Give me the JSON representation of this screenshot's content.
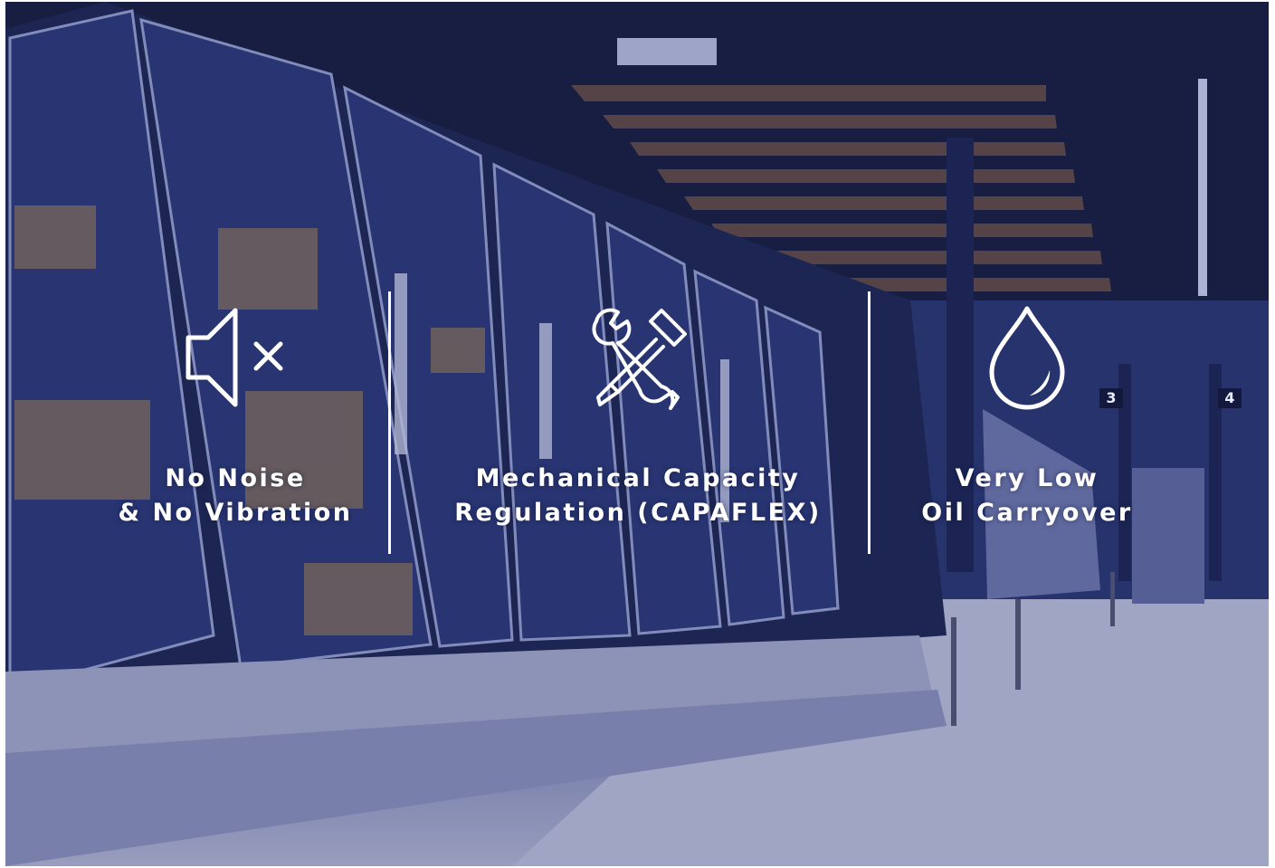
{
  "features": [
    {
      "icon": "mute-speaker-icon",
      "line1": "No Noise",
      "line2": "& No Vibration"
    },
    {
      "icon": "wrench-screwdriver-icon",
      "line1": "Mechanical Capacity",
      "line2": "Regulation (CAPAFLEX)"
    },
    {
      "icon": "oil-drop-icon",
      "line1": "Very Low",
      "line2": "Oil Carryover"
    }
  ],
  "aisle_signs": [
    "3",
    "4"
  ],
  "colors": {
    "overlay": "#1c245c",
    "text": "#ffffff"
  }
}
